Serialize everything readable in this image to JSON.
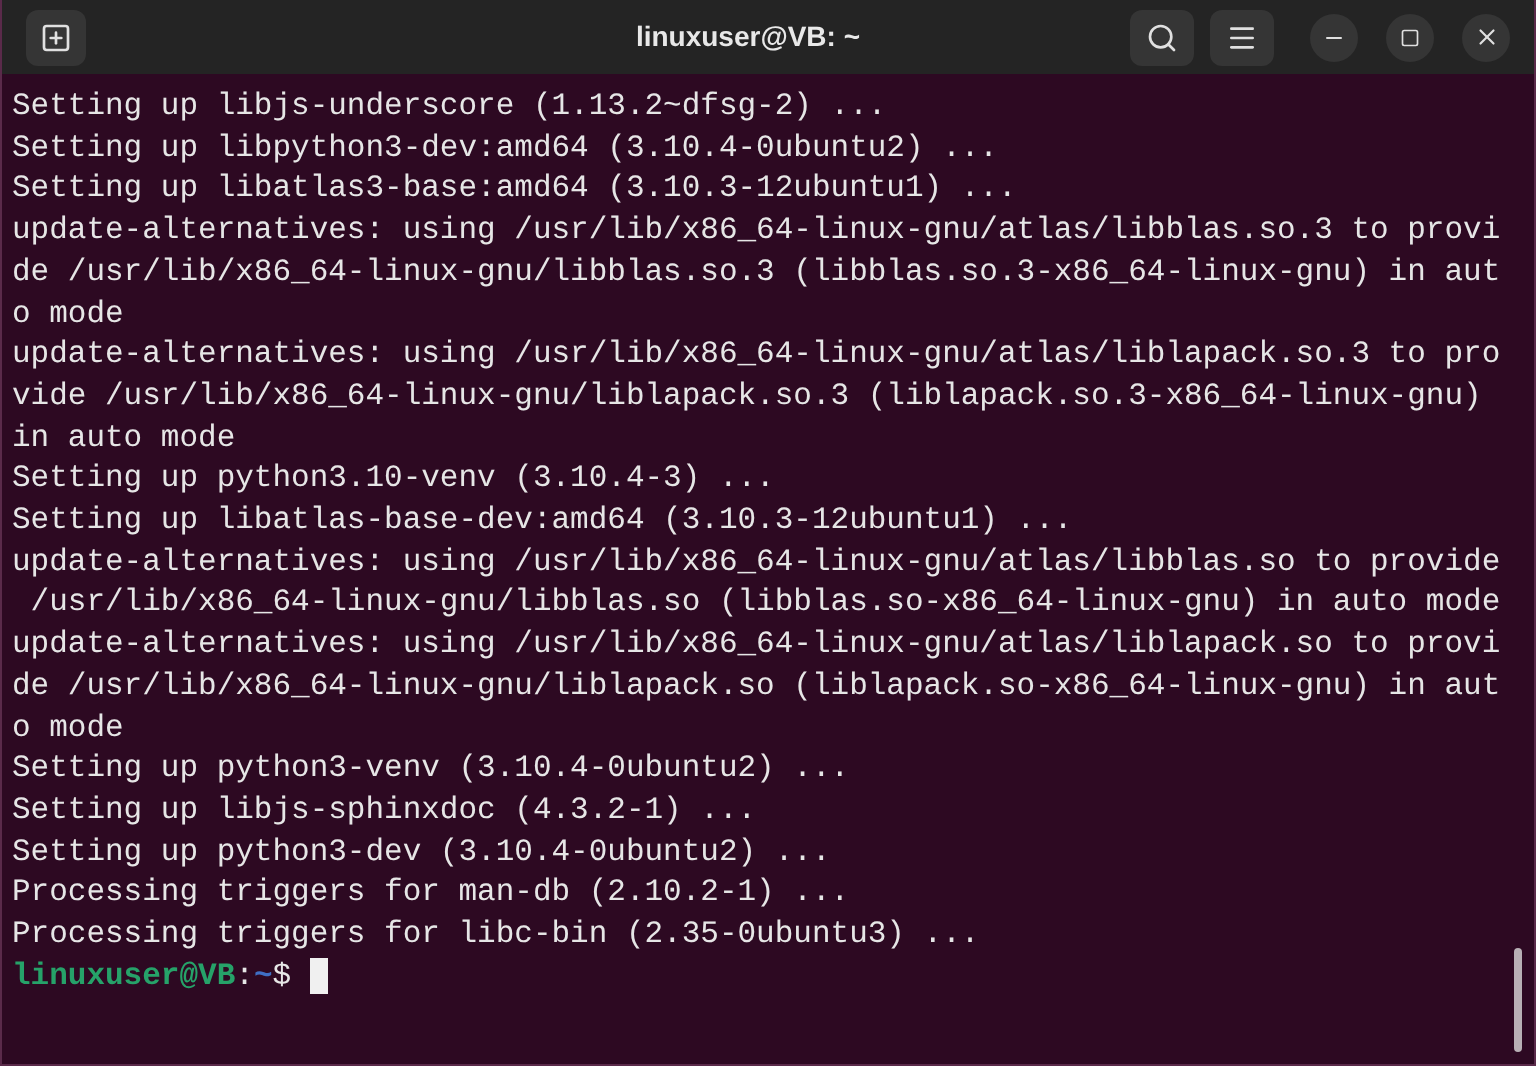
{
  "window": {
    "title": "linuxuser@VB: ~"
  },
  "terminal": {
    "lines": [
      "Setting up libjs-underscore (1.13.2~dfsg-2) ...",
      "Setting up libpython3-dev:amd64 (3.10.4-0ubuntu2) ...",
      "Setting up libatlas3-base:amd64 (3.10.3-12ubuntu1) ...",
      "update-alternatives: using /usr/lib/x86_64-linux-gnu/atlas/libblas.so.3 to provi",
      "de /usr/lib/x86_64-linux-gnu/libblas.so.3 (libblas.so.3-x86_64-linux-gnu) in aut",
      "o mode",
      "update-alternatives: using /usr/lib/x86_64-linux-gnu/atlas/liblapack.so.3 to pro",
      "vide /usr/lib/x86_64-linux-gnu/liblapack.so.3 (liblapack.so.3-x86_64-linux-gnu)",
      "in auto mode",
      "Setting up python3.10-venv (3.10.4-3) ...",
      "Setting up libatlas-base-dev:amd64 (3.10.3-12ubuntu1) ...",
      "update-alternatives: using /usr/lib/x86_64-linux-gnu/atlas/libblas.so to provide",
      " /usr/lib/x86_64-linux-gnu/libblas.so (libblas.so-x86_64-linux-gnu) in auto mode",
      "update-alternatives: using /usr/lib/x86_64-linux-gnu/atlas/liblapack.so to provi",
      "de /usr/lib/x86_64-linux-gnu/liblapack.so (liblapack.so-x86_64-linux-gnu) in aut",
      "o mode",
      "Setting up python3-venv (3.10.4-0ubuntu2) ...",
      "Setting up libjs-sphinxdoc (4.3.2-1) ...",
      "Setting up python3-dev (3.10.4-0ubuntu2) ...",
      "Processing triggers for man-db (2.10.2-1) ...",
      "Processing triggers for libc-bin (2.35-0ubuntu3) ..."
    ],
    "prompt": {
      "user_host": "linuxuser@VB",
      "separator": ":",
      "path": "~",
      "symbol": "$"
    }
  }
}
